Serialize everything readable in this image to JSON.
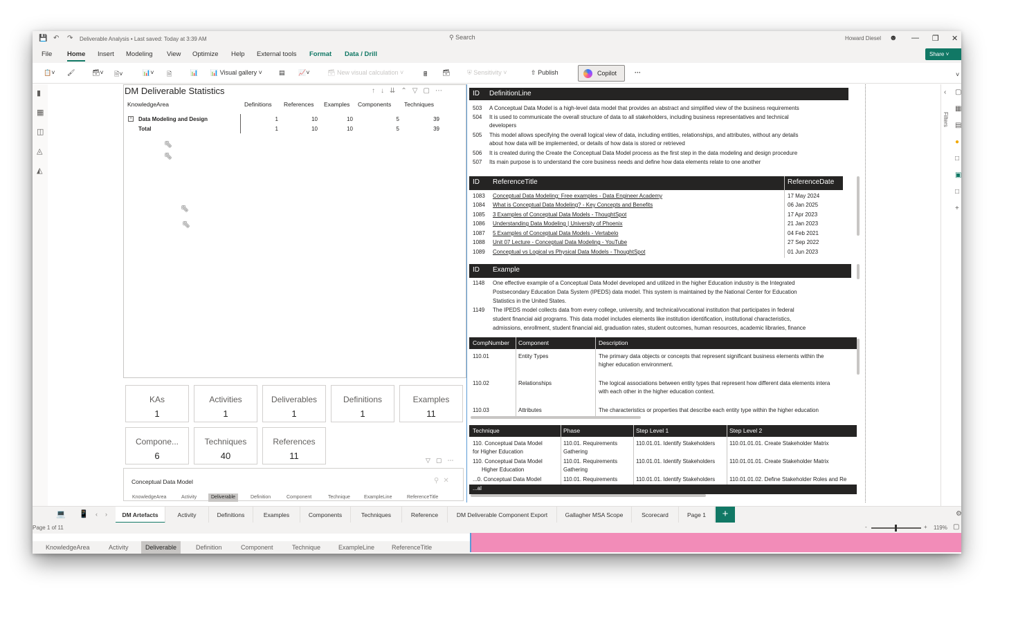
{
  "titlebar": {
    "doc_title": "Deliverable Analysis • Last saved: Today at 3:39 AM",
    "search_placeholder": "Search",
    "user": "Howard Diesel"
  },
  "menu": [
    "File",
    "Home",
    "Insert",
    "Modeling",
    "View",
    "Optimize",
    "Help",
    "External tools",
    "Format",
    "Data / Drill"
  ],
  "menu_active": "Home",
  "share_label": "Share",
  "ribbon": {
    "visual_gallery": "Visual gallery",
    "new_visual_calc": "New visual calculation",
    "sensitivity": "Sensitivity",
    "publish": "Publish",
    "copilot": "Copilot",
    "more": "···"
  },
  "filters_label": "Filters",
  "matrix": {
    "title": "DM Deliverable Statistics",
    "columns": [
      "KnowledgeArea",
      "Definitions",
      "References",
      "Examples",
      "Components",
      "Techniques"
    ],
    "rows": [
      {
        "label": "Data Modeling and Design",
        "values": [
          "1",
          "10",
          "10",
          "5",
          "39"
        ]
      },
      {
        "label": "Total",
        "values": [
          "1",
          "10",
          "10",
          "5",
          "39"
        ]
      }
    ]
  },
  "cards": [
    {
      "title": "KAs",
      "value": "1"
    },
    {
      "title": "Activities",
      "value": "1"
    },
    {
      "title": "Deliverables",
      "value": "1"
    },
    {
      "title": "Definitions",
      "value": "1"
    },
    {
      "title": "Examples",
      "value": "11"
    },
    {
      "title": "Compone...",
      "value": "6"
    },
    {
      "title": "Techniques",
      "value": "40"
    },
    {
      "title": "References",
      "value": "11"
    }
  ],
  "slicer": {
    "value": "Conceptual Data Model",
    "chips": [
      "KnowledgeArea",
      "Activity",
      "Deliverable",
      "Definition",
      "Component",
      "Technique",
      "ExampleLine",
      "ReferenceTitle"
    ],
    "selected": "Deliverable"
  },
  "definitions": {
    "headers": [
      "ID",
      "DefinitionLine"
    ],
    "rows": [
      {
        "id": "503",
        "text": "A Conceptual Data Model is a high-level data model that provides an abstract and simplified view of the business requirements"
      },
      {
        "id": "504",
        "text": "It is used to communicate the overall structure of data to all stakeholders, including business representatives and technical"
      },
      {
        "id": "",
        "text": "developers"
      },
      {
        "id": "505",
        "text": "This model allows specifying the overall logical view of data, including entities, relationships, and attributes, without any details"
      },
      {
        "id": "",
        "text": "about how data will be implemented, or details of how data is stored or retrieved"
      },
      {
        "id": "506",
        "text": "It is created during the Create the Conceptual Data Model process as the first step in the data modeling and design procedure"
      },
      {
        "id": "507",
        "text": "Its main purpose is to understand the core business needs and define how data elements relate to one another"
      }
    ]
  },
  "references": {
    "headers": [
      "ID",
      "ReferenceTitle",
      "ReferenceDate"
    ],
    "rows": [
      {
        "id": "1083",
        "title": "Conceptual Data Modeling: Free examples - Data Engineer Academy",
        "date": "17 May 2024"
      },
      {
        "id": "1084",
        "title": "What is Conceptual Data Modeling? - Key Concepts and Benefits",
        "date": "06 Jan 2025"
      },
      {
        "id": "1085",
        "title": "3 Examples of Conceptual Data Models - ThoughtSpot",
        "date": "17 Apr 2023"
      },
      {
        "id": "1086",
        "title": "Understanding Data Modeling | University of Phoenix",
        "date": "21 Jan 2023"
      },
      {
        "id": "1087",
        "title": "5 Examples of Conceptual Data Models - Vertabelo",
        "date": "04 Feb 2021"
      },
      {
        "id": "1088",
        "title": "Unit 07 Lecture - Conceptual Data Modeling - YouTube",
        "date": "27 Sep 2022"
      },
      {
        "id": "1089",
        "title": "Conceptual vs Logical vs Physical Data Models - ThoughtSpot",
        "date": "01 Jun 2023"
      }
    ]
  },
  "examples": {
    "headers": [
      "ID",
      "Example"
    ],
    "rows": [
      {
        "id": "1148",
        "lines": [
          "One effective example of a Conceptual Data Model developed and utilized in the higher Education industry is the Integrated",
          "Postsecondary Education Data System (IPEDS) data model. This system is maintained by the National Center for Education",
          "Statistics in the United States."
        ]
      },
      {
        "id": "1149",
        "lines": [
          "The IPEDS model collects data from every college, university, and technical/vocational institution that participates in federal",
          "student financial aid programs. This data model includes elements like institution identification, institutional characteristics,",
          "admissions, enrollment, student financial aid, graduation rates, student outcomes, human resources, academic libraries, finance"
        ]
      }
    ]
  },
  "components": {
    "headers": [
      "CompNumber",
      "Component",
      "Description"
    ],
    "rows": [
      {
        "num": "110.01",
        "name": "Entity Types",
        "desc": [
          "The primary data objects or concepts that represent significant business elements within the",
          "higher education environment."
        ]
      },
      {
        "num": "110.02",
        "name": "Relationships",
        "desc": [
          "The logical associations between entity types that represent how different data elements intera",
          "with each other in the higher education context."
        ]
      },
      {
        "num": "110.03",
        "name": "Attributes",
        "desc": [
          "The characteristics or properties that describe each entity type within the higher education"
        ]
      }
    ]
  },
  "techniques": {
    "headers": [
      "Technique",
      "Phase",
      "Step Level 1",
      "Step Level 2"
    ],
    "rows": [
      {
        "t": [
          "110. Conceptual Data Model",
          "for Higher Education"
        ],
        "p": [
          "110.01. Requirements",
          "Gathering"
        ],
        "s1": "110.01.01. Identify Stakeholders",
        "s2": "110.01.01.01. Create Stakeholder Matrix"
      },
      {
        "t": [
          "110. Conceptual Data Model",
          "Higher Education"
        ],
        "p": [
          "110.01. Requirements",
          "Gathering"
        ],
        "s1": "110.01.01. Identify Stakeholders",
        "s2": "110.01.01.01. Create Stakeholder Matrix"
      },
      {
        "t": [
          "...0. Conceptual Data Model",
          ""
        ],
        "p": [
          "110.01. Requirements",
          ""
        ],
        "s1": "110.01.01. Identify Stakeholders",
        "s2": "110.01.01.02. Define Stakeholder Roles and Re"
      }
    ],
    "total_label": "...al"
  },
  "tabs": [
    "DM Artefacts",
    "Activity",
    "Definitions",
    "Examples",
    "Components",
    "Techniques",
    "Reference",
    "DM Deliverable Component Export",
    "Gallagher MSA Scope",
    "Scorecard",
    "Page 1"
  ],
  "tab_active": "DM Artefacts",
  "status": {
    "page": "Page 1 of 11",
    "zoom": "119%"
  },
  "bottom_chips": [
    "KnowledgeArea",
    "Activity",
    "Deliverable",
    "Definition",
    "Component",
    "Technique",
    "ExampleLine",
    "ReferenceTitle"
  ],
  "bottom_selected": "Deliverable",
  "colors": {
    "accent": "#117865",
    "header": "#252423",
    "pink": "#f28cb8"
  }
}
